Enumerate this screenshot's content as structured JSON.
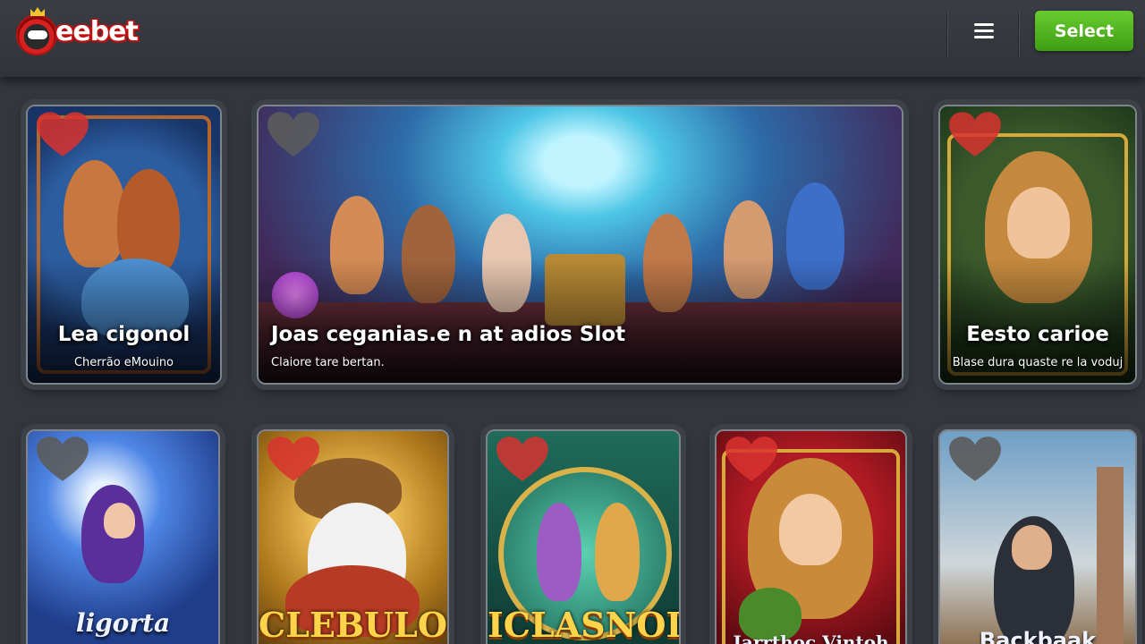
{
  "header": {
    "logo_text": "eebet",
    "select_label": "Select"
  },
  "featured_games": [
    {
      "title": "Lea cigonol",
      "subtitle": "Cherrão eMouino"
    },
    {
      "title": "Joas ceganias.e n at adios Slot",
      "subtitle": "Claiore tare bertan."
    },
    {
      "title": "Eesto carioe",
      "subtitle": "Blase dura quaste re la voduj"
    }
  ],
  "games": [
    {
      "title": "ligorta"
    },
    {
      "title": "CLEBULO"
    },
    {
      "title": "ICLASNOI"
    },
    {
      "title": "Jarrthoc Vintoh"
    },
    {
      "title": "Backbaak"
    }
  ],
  "colors": {
    "accent_green": "#4fb51f",
    "heart_red": "#d8322f",
    "heart_gray": "#5b5b5b",
    "background": "#33373d"
  }
}
